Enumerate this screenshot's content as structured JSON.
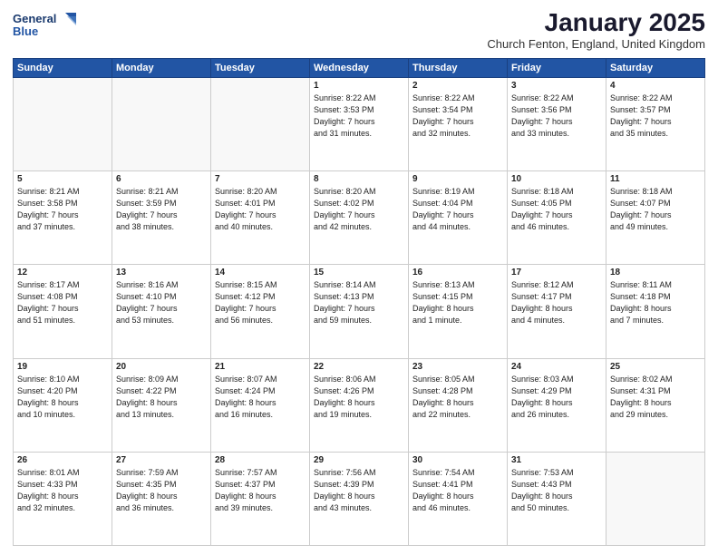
{
  "logo": {
    "line1": "General",
    "line2": "Blue"
  },
  "title": "January 2025",
  "subtitle": "Church Fenton, England, United Kingdom",
  "weekdays": [
    "Sunday",
    "Monday",
    "Tuesday",
    "Wednesday",
    "Thursday",
    "Friday",
    "Saturday"
  ],
  "weeks": [
    [
      {
        "day": "",
        "info": ""
      },
      {
        "day": "",
        "info": ""
      },
      {
        "day": "",
        "info": ""
      },
      {
        "day": "1",
        "info": "Sunrise: 8:22 AM\nSunset: 3:53 PM\nDaylight: 7 hours\nand 31 minutes."
      },
      {
        "day": "2",
        "info": "Sunrise: 8:22 AM\nSunset: 3:54 PM\nDaylight: 7 hours\nand 32 minutes."
      },
      {
        "day": "3",
        "info": "Sunrise: 8:22 AM\nSunset: 3:56 PM\nDaylight: 7 hours\nand 33 minutes."
      },
      {
        "day": "4",
        "info": "Sunrise: 8:22 AM\nSunset: 3:57 PM\nDaylight: 7 hours\nand 35 minutes."
      }
    ],
    [
      {
        "day": "5",
        "info": "Sunrise: 8:21 AM\nSunset: 3:58 PM\nDaylight: 7 hours\nand 37 minutes."
      },
      {
        "day": "6",
        "info": "Sunrise: 8:21 AM\nSunset: 3:59 PM\nDaylight: 7 hours\nand 38 minutes."
      },
      {
        "day": "7",
        "info": "Sunrise: 8:20 AM\nSunset: 4:01 PM\nDaylight: 7 hours\nand 40 minutes."
      },
      {
        "day": "8",
        "info": "Sunrise: 8:20 AM\nSunset: 4:02 PM\nDaylight: 7 hours\nand 42 minutes."
      },
      {
        "day": "9",
        "info": "Sunrise: 8:19 AM\nSunset: 4:04 PM\nDaylight: 7 hours\nand 44 minutes."
      },
      {
        "day": "10",
        "info": "Sunrise: 8:18 AM\nSunset: 4:05 PM\nDaylight: 7 hours\nand 46 minutes."
      },
      {
        "day": "11",
        "info": "Sunrise: 8:18 AM\nSunset: 4:07 PM\nDaylight: 7 hours\nand 49 minutes."
      }
    ],
    [
      {
        "day": "12",
        "info": "Sunrise: 8:17 AM\nSunset: 4:08 PM\nDaylight: 7 hours\nand 51 minutes."
      },
      {
        "day": "13",
        "info": "Sunrise: 8:16 AM\nSunset: 4:10 PM\nDaylight: 7 hours\nand 53 minutes."
      },
      {
        "day": "14",
        "info": "Sunrise: 8:15 AM\nSunset: 4:12 PM\nDaylight: 7 hours\nand 56 minutes."
      },
      {
        "day": "15",
        "info": "Sunrise: 8:14 AM\nSunset: 4:13 PM\nDaylight: 7 hours\nand 59 minutes."
      },
      {
        "day": "16",
        "info": "Sunrise: 8:13 AM\nSunset: 4:15 PM\nDaylight: 8 hours\nand 1 minute."
      },
      {
        "day": "17",
        "info": "Sunrise: 8:12 AM\nSunset: 4:17 PM\nDaylight: 8 hours\nand 4 minutes."
      },
      {
        "day": "18",
        "info": "Sunrise: 8:11 AM\nSunset: 4:18 PM\nDaylight: 8 hours\nand 7 minutes."
      }
    ],
    [
      {
        "day": "19",
        "info": "Sunrise: 8:10 AM\nSunset: 4:20 PM\nDaylight: 8 hours\nand 10 minutes."
      },
      {
        "day": "20",
        "info": "Sunrise: 8:09 AM\nSunset: 4:22 PM\nDaylight: 8 hours\nand 13 minutes."
      },
      {
        "day": "21",
        "info": "Sunrise: 8:07 AM\nSunset: 4:24 PM\nDaylight: 8 hours\nand 16 minutes."
      },
      {
        "day": "22",
        "info": "Sunrise: 8:06 AM\nSunset: 4:26 PM\nDaylight: 8 hours\nand 19 minutes."
      },
      {
        "day": "23",
        "info": "Sunrise: 8:05 AM\nSunset: 4:28 PM\nDaylight: 8 hours\nand 22 minutes."
      },
      {
        "day": "24",
        "info": "Sunrise: 8:03 AM\nSunset: 4:29 PM\nDaylight: 8 hours\nand 26 minutes."
      },
      {
        "day": "25",
        "info": "Sunrise: 8:02 AM\nSunset: 4:31 PM\nDaylight: 8 hours\nand 29 minutes."
      }
    ],
    [
      {
        "day": "26",
        "info": "Sunrise: 8:01 AM\nSunset: 4:33 PM\nDaylight: 8 hours\nand 32 minutes."
      },
      {
        "day": "27",
        "info": "Sunrise: 7:59 AM\nSunset: 4:35 PM\nDaylight: 8 hours\nand 36 minutes."
      },
      {
        "day": "28",
        "info": "Sunrise: 7:57 AM\nSunset: 4:37 PM\nDaylight: 8 hours\nand 39 minutes."
      },
      {
        "day": "29",
        "info": "Sunrise: 7:56 AM\nSunset: 4:39 PM\nDaylight: 8 hours\nand 43 minutes."
      },
      {
        "day": "30",
        "info": "Sunrise: 7:54 AM\nSunset: 4:41 PM\nDaylight: 8 hours\nand 46 minutes."
      },
      {
        "day": "31",
        "info": "Sunrise: 7:53 AM\nSunset: 4:43 PM\nDaylight: 8 hours\nand 50 minutes."
      },
      {
        "day": "",
        "info": ""
      }
    ]
  ]
}
